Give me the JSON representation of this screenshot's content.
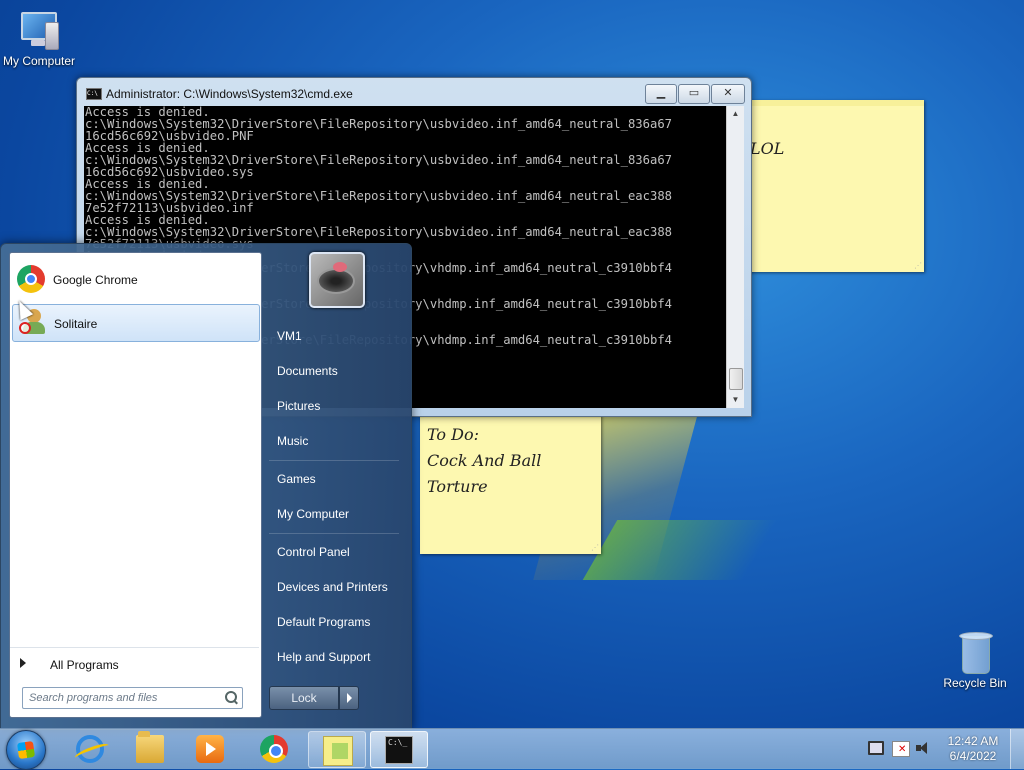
{
  "desktop": {
    "icons": [
      {
        "label": "My Computer",
        "icon": "my-computer-icon"
      },
      {
        "label": "Recycle Bin",
        "icon": "recycle-bin-icon"
      }
    ]
  },
  "sticky_notes": [
    {
      "text": "LOL"
    },
    {
      "lines": [
        "To Do:",
        "Cock And Ball",
        "Torture"
      ]
    }
  ],
  "cmd_window": {
    "title": "Administrator: C:\\Windows\\System32\\cmd.exe",
    "console_lines": [
      "Access is denied.",
      "c:\\Windows\\System32\\DriverStore\\FileRepository\\usbvideo.inf_amd64_neutral_836a67",
      "16cd56c692\\usbvideo.PNF",
      "Access is denied.",
      "c:\\Windows\\System32\\DriverStore\\FileRepository\\usbvideo.inf_amd64_neutral_836a67",
      "16cd56c692\\usbvideo.sys",
      "Access is denied.",
      "c:\\Windows\\System32\\DriverStore\\FileRepository\\usbvideo.inf_amd64_neutral_eac388",
      "7e52f72113\\usbvideo.inf",
      "Access is denied.",
      "c:\\Windows\\System32\\DriverStore\\FileRepository\\usbvideo.inf_amd64_neutral_eac388",
      "7e52f72113\\usbvideo.sys",
      "Access is denied.",
      "c:\\Windows\\System32\\DriverStore\\FileRepository\\vhdmp.inf_amd64_neutral_c3910bbf4",
      "",
      "",
      "c:\\Windows\\System32\\DriverStore\\FileRepository\\vhdmp.inf_amd64_neutral_c3910bbf4",
      "",
      "",
      "c:\\Windows\\System32\\DriverStore\\FileRepository\\vhdmp.inf_amd64_neutral_c3910bbf4"
    ],
    "buttons": {
      "minimize": "▁",
      "maximize": "▭",
      "close": "✕"
    }
  },
  "start_menu": {
    "pinned_programs": [
      {
        "label": "Google Chrome",
        "icon": "chrome-icon"
      },
      {
        "label": "Solitaire",
        "icon": "solitaire-icon",
        "selected": true
      }
    ],
    "all_programs_label": "All Programs",
    "search_placeholder": "Search programs and files",
    "right_items": [
      {
        "label": "VM1"
      },
      {
        "label": "Documents"
      },
      {
        "label": "Pictures"
      },
      {
        "label": "Music"
      },
      {
        "label": "Games"
      },
      {
        "label": "My Computer"
      },
      {
        "label": "Control Panel"
      },
      {
        "label": "Devices and Printers"
      },
      {
        "label": "Default Programs"
      },
      {
        "label": "Help and Support"
      }
    ],
    "lock_label": "Lock"
  },
  "taskbar": {
    "buttons": [
      {
        "icon": "internet-explorer-icon"
      },
      {
        "icon": "file-explorer-icon"
      },
      {
        "icon": "media-player-icon"
      },
      {
        "icon": "chrome-icon"
      },
      {
        "icon": "sticky-notes-icon"
      },
      {
        "icon": "cmd-icon"
      }
    ],
    "clock_time": "12:42 AM",
    "clock_date": "6/4/2022"
  },
  "colors": {
    "console_bg": "#000000",
    "console_fg": "#c0c0c0",
    "note_bg": "#fdf8b0"
  }
}
